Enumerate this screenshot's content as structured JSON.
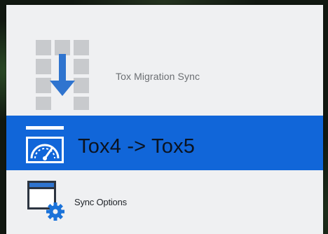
{
  "app": {
    "title": "Tox Migration Sync",
    "logo_icon": "migration-download-icon"
  },
  "nav": {
    "active_item": {
      "label": "Tox4 -> Tox5",
      "icon": "gauge-icon",
      "selected": true
    },
    "items": [
      {
        "label": "Sync Options",
        "icon": "settings-window-icon"
      }
    ]
  },
  "colors": {
    "accent": "#1166d9",
    "panel_background": "#eff0f2",
    "logo_gray": "#c8cacd",
    "arrow_blue": "#2f74cf"
  }
}
